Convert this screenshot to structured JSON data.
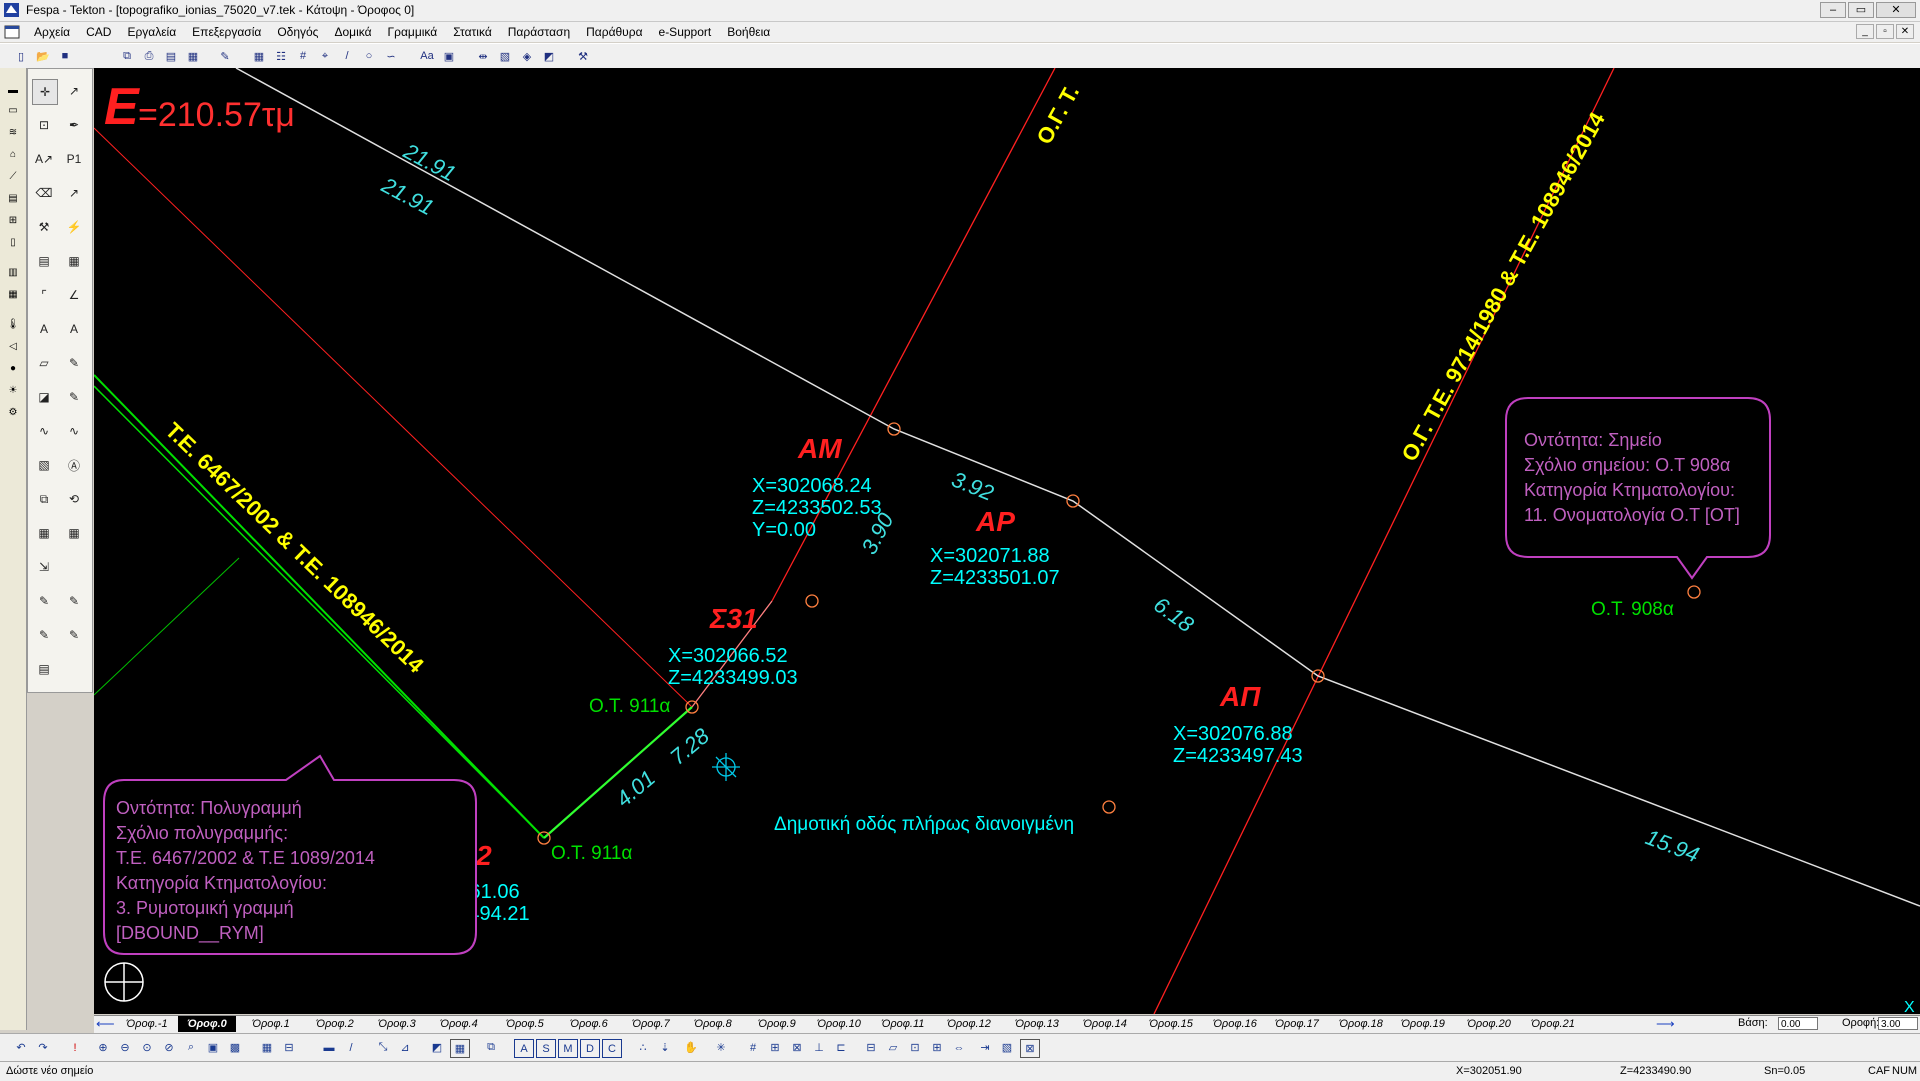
{
  "window": {
    "title": "Fespa - Tekton - [topografiko_ionias_75020_v7.tek - Κάτοψη - Όροφος 0]"
  },
  "menu": [
    "Αρχεία",
    "CAD",
    "Εργαλεία",
    "Επεξεργασία",
    "Οδηγός",
    "Δομικά",
    "Γραμμικά",
    "Στατικά",
    "Παράσταση",
    "Παράθυρα",
    "e-Support",
    "Βοήθεια"
  ],
  "drawing": {
    "area_letter": "E",
    "area_value": "=210.57τμ",
    "dims": {
      "d1": "21.91",
      "d2": "21.91",
      "d3": "3.92",
      "d4": "6.18",
      "d5": "15.94",
      "d6": "3.90",
      "d7": "7.28",
      "d8": "4.01"
    },
    "street_left": "Τ.Ε. 6467/2002 & Τ.Ε. 108946/2014",
    "street_right": "Ο.Γ.   Τ.Ε. 9714/1980 & Τ.Ε. 108946/2014",
    "street_top": "Ο.Γ.  Τ.",
    "points": {
      "AM": {
        "label": "ΑΜ",
        "x": "X=302068.24",
        "z": "Z=4233502.53",
        "y": "Y=0.00"
      },
      "AR": {
        "label": "ΑΡ",
        "x": "X=302071.88",
        "z": "Z=4233501.07"
      },
      "S31": {
        "label": "Σ31",
        "x": "X=302066.52",
        "z": "Z=4233499.03"
      },
      "AP": {
        "label": "ΑΠ",
        "x": "X=302076.88",
        "z": "Z=4233497.43"
      },
      "S32": {
        "label": "Σ32",
        "x": "X=302061.06",
        "z": "Z=4233494.21"
      }
    },
    "ot_911a_1": "Ο.Τ. 911α",
    "ot_911a_2": "Ο.Τ. 911α",
    "ot_908a": "Ο.Τ. 908α",
    "road_label": "Δημοτική οδός πλήρως διανοιγμένη",
    "tooltip_right": {
      "l1": "Οντότητα: Σημείο",
      "l2": "Σχόλιο σημείου: Ο.Τ 908α",
      "l3": "Κατηγορία Κτηματολογίου:",
      "l4": "11. Ονοματολογία Ο.Τ [ΟΤ]"
    },
    "tooltip_left": {
      "l1": "Οντότητα: Πολυγραμμή",
      "l2": "Σχόλιο πολυγραμμής:",
      "l3": "Τ.Ε. 6467/2002 & Τ.Ε 1089/2014",
      "l4": "Κατηγορία Κτηματολογίου:",
      "l5": "3. Ρυμοτομική γραμμή",
      "l6": "[DBOUND__RYM]"
    },
    "corner_x": "X"
  },
  "floors": [
    "Όροφ.-1",
    "Όροφ.0",
    "Όροφ.1",
    "Όροφ.2",
    "Όροφ.3",
    "Όροφ.4",
    "Όροφ.5",
    "Όροφ.6",
    "Όροφ.7",
    "Όροφ.8",
    "Όροφ.9",
    "Όροφ.10",
    "Όροφ.11",
    "Όροφ.12",
    "Όροφ.13",
    "Όροφ.14",
    "Όροφ.15",
    "Όροφ.16",
    "Όροφ.17",
    "Όροφ.18",
    "Όροφ.19",
    "Όροφ.20",
    "Όροφ.21"
  ],
  "active_floor": "Όροφ.0",
  "floorbar": {
    "basi_label": "Βάση:",
    "basi_value": "0.00",
    "orofi_label": "Οροφή:",
    "orofi_value": "3.00"
  },
  "status": {
    "message": "Δώστε νέο σημείο",
    "x": "X=302051.90",
    "z": "Z=4233490.90",
    "sn": "Sn=0.05",
    "caf": "CAF",
    "num": "NUM"
  },
  "colors": {
    "canvas_bg": "#000000",
    "red_line": "#ff2020",
    "white_line": "#e0e0e0",
    "cyan_text": "#00ffff",
    "yellow_text": "#ffff00",
    "green": "#00e000",
    "violet": "#c040c0"
  }
}
